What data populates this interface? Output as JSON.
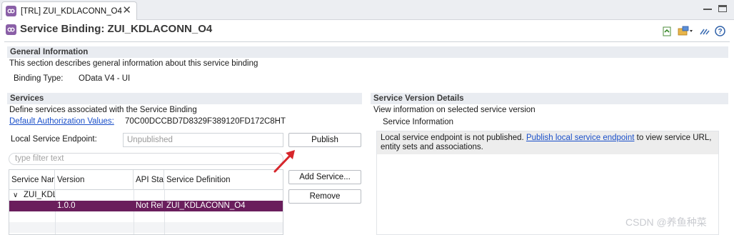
{
  "tab": {
    "title": "[TRL] ZUI_KDLACONN_O4",
    "close": "✕"
  },
  "header": {
    "title": "Service Binding: ZUI_KDLACONN_O4",
    "help_icon": "?"
  },
  "general": {
    "title": "General Information",
    "description": "This section describes general information about this service binding",
    "binding_type_label": "Binding Type:",
    "binding_type_value": "OData V4 - UI"
  },
  "services": {
    "title": "Services",
    "description": "Define services associated with the Service Binding",
    "auth_link": "Default Authorization Values:",
    "auth_value": "70C00DCCBD7D8329F389120FD172C8HT",
    "endpoint_label": "Local Service Endpoint:",
    "endpoint_value": "Unpublished",
    "publish_button": "Publish",
    "filter_placeholder": "type filter text",
    "add_service_button": "Add Service...",
    "remove_button": "Remove",
    "table": {
      "columns": [
        "Service Nar",
        "Version",
        "API Stat",
        "Service Definition"
      ],
      "group_row": {
        "expander": "∨",
        "name": "ZUI_KDL"
      },
      "selected_row": {
        "version": "1.0.0",
        "api_state": "Not Rel",
        "definition": "ZUI_KDLACONN_O4"
      }
    }
  },
  "version_details": {
    "title": "Service Version Details",
    "description": "View information on selected service version",
    "info_heading": "Service Information",
    "msg_prefix": "Local service endpoint is not published. ",
    "msg_link": "Publish local service endpoint",
    "msg_suffix": " to view service URL, entity sets and associations."
  },
  "watermark": "CSDN @养鱼种菜",
  "colors": {
    "selection": "#6a1e5c",
    "arrow": "#d7262b",
    "link": "#1a4fc9",
    "section_bar": "#e9ecf1"
  }
}
